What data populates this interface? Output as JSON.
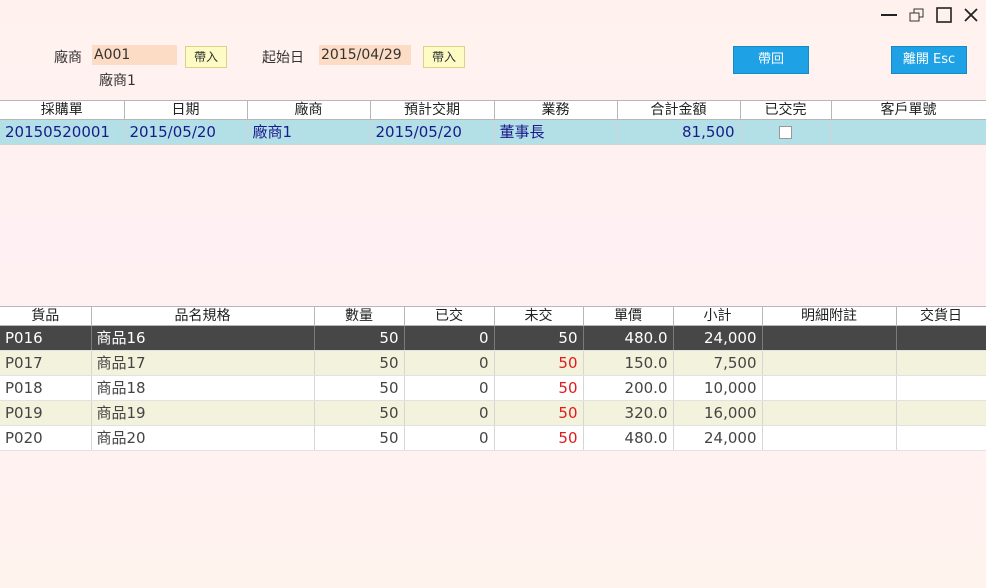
{
  "filters": {
    "vendor_label": "廠商",
    "vendor_code": "A001",
    "vendor_name": "廠商1",
    "vendor_import": "帶入",
    "start_label": "起始日",
    "start_date": "2015/04/29",
    "start_import": "帶入"
  },
  "actions": {
    "bring_back": "帶回",
    "exit": "離開 Esc"
  },
  "orders": {
    "columns": [
      "採購單",
      "日期",
      "廠商",
      "預計交期",
      "業務",
      "合計金額",
      "已交完",
      "客戶單號"
    ],
    "rows": [
      {
        "po": "20150520001",
        "date": "2015/05/20",
        "vendor": "廠商1",
        "due": "2015/05/20",
        "sales": "董事長",
        "total": "81,500",
        "done": false,
        "cust_no": ""
      }
    ]
  },
  "details": {
    "columns": [
      "貨品",
      "品名規格",
      "數量",
      "已交",
      "未交",
      "單價",
      "小計",
      "明細附註",
      "交貨日"
    ],
    "rows": [
      {
        "item": "P016",
        "name": "商品16",
        "qty": "50",
        "delivered": "0",
        "pending": "50",
        "price": "480.0",
        "subtotal": "24,000",
        "note": "",
        "delivery_date": ""
      },
      {
        "item": "P017",
        "name": "商品17",
        "qty": "50",
        "delivered": "0",
        "pending": "50",
        "price": "150.0",
        "subtotal": "7,500",
        "note": "",
        "delivery_date": ""
      },
      {
        "item": "P018",
        "name": "商品18",
        "qty": "50",
        "delivered": "0",
        "pending": "50",
        "price": "200.0",
        "subtotal": "10,000",
        "note": "",
        "delivery_date": ""
      },
      {
        "item": "P019",
        "name": "商品19",
        "qty": "50",
        "delivered": "0",
        "pending": "50",
        "price": "320.0",
        "subtotal": "16,000",
        "note": "",
        "delivery_date": ""
      },
      {
        "item": "P020",
        "name": "商品20",
        "qty": "50",
        "delivered": "0",
        "pending": "50",
        "price": "480.0",
        "subtotal": "24,000",
        "note": "",
        "delivery_date": ""
      }
    ]
  },
  "colors": {
    "accent": "#1fa2e5",
    "selected_order_row": "#b2e0e6",
    "selected_detail_row": "#474747",
    "pending_red": "#e31b1b"
  },
  "icons": [
    "minimize-icon",
    "restore-icon",
    "maximize-icon",
    "close-icon"
  ]
}
